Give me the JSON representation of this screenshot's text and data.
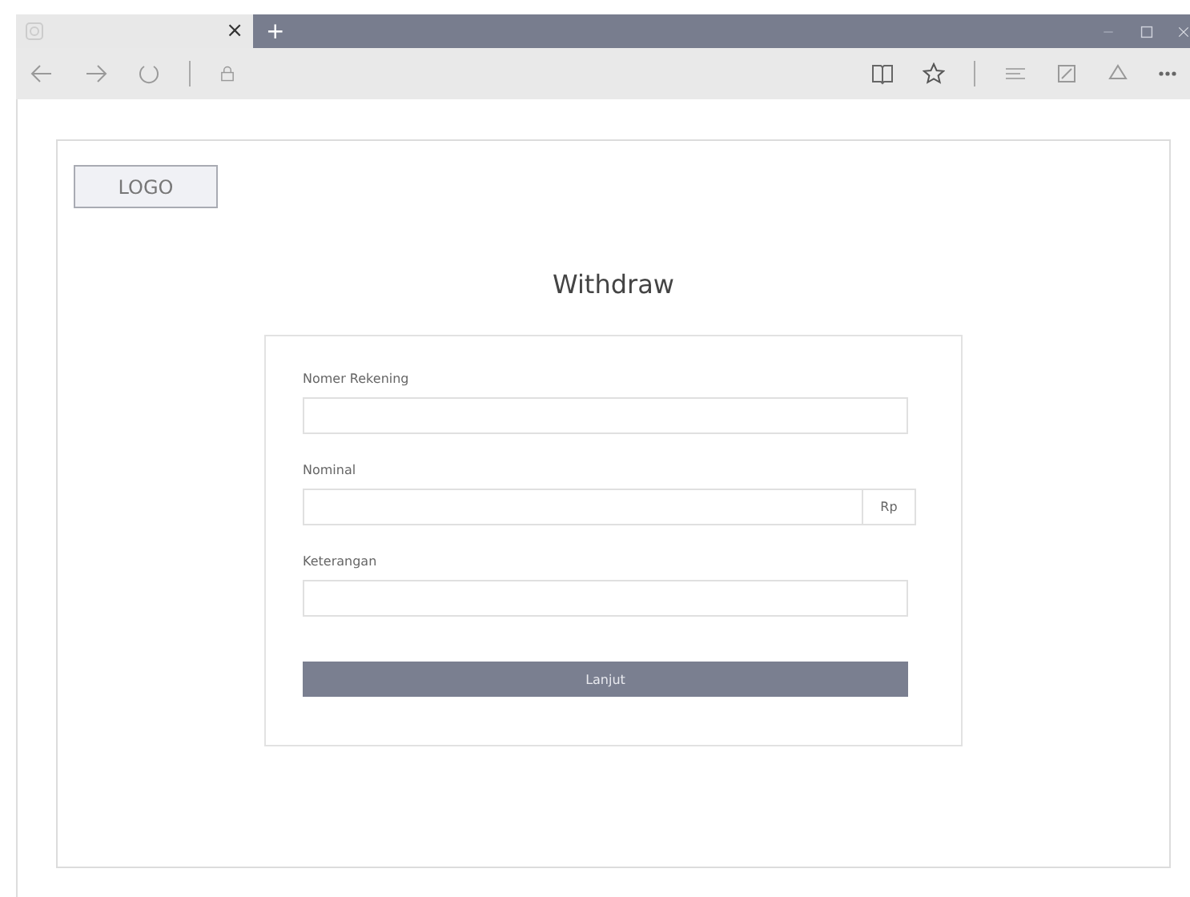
{
  "browser": {
    "tab_close": "×",
    "new_tab": "+"
  },
  "logo": "LOGO",
  "title": "Withdraw",
  "fields": [
    {
      "label": "Nomer Rekening",
      "kind": "text"
    },
    {
      "label": "Nominal",
      "kind": "addon",
      "addon": "Rp"
    },
    {
      "label": "Keterangan",
      "kind": "text"
    }
  ],
  "submit": "Lanjut"
}
